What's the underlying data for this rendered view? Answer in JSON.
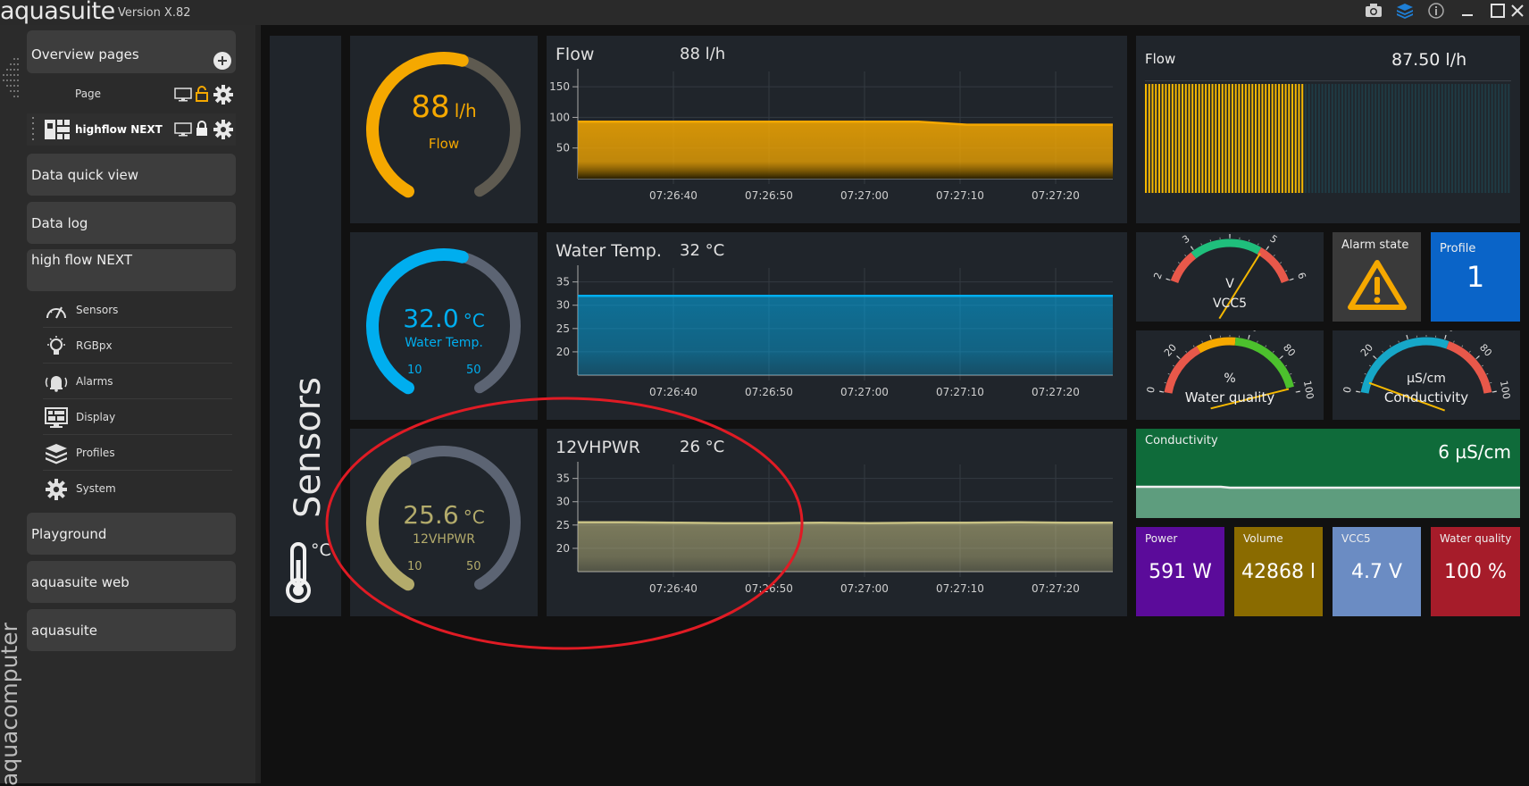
{
  "app": {
    "title": "aquasuite",
    "version": "Version X.82"
  },
  "titlebar_icons": [
    "camera-icon",
    "layers-icon",
    "info-icon",
    "minimize-icon",
    "maximize-icon",
    "close-icon"
  ],
  "sidebar": {
    "overview_label": "Overview pages",
    "pages": [
      {
        "label": "Page"
      },
      {
        "label": "highflow NEXT"
      }
    ],
    "sections": [
      {
        "label": "Data quick view"
      },
      {
        "label": "Data log"
      },
      {
        "label": "high flow NEXT"
      }
    ],
    "device_items": [
      {
        "label": "Sensors",
        "icon": "gauge-icon"
      },
      {
        "label": "RGBpx",
        "icon": "lightbulb-icon"
      },
      {
        "label": "Alarms",
        "icon": "alarm-bell-icon"
      },
      {
        "label": "Display",
        "icon": "display-icon"
      },
      {
        "label": "Profiles",
        "icon": "layers-icon"
      },
      {
        "label": "System",
        "icon": "gear-icon"
      }
    ],
    "bottom_sections": [
      {
        "label": "Playground"
      },
      {
        "label": "aquasuite web"
      },
      {
        "label": "aquasuite"
      }
    ],
    "brand_vertical": "aquacomputer"
  },
  "sensors_panel": {
    "title": "Sensors",
    "unit_icon": "°C"
  },
  "gauges": [
    {
      "value": "88",
      "unit": "l/h",
      "label": "Flow",
      "color": "#f5a800",
      "fraction": 0.55,
      "min": "",
      "max": ""
    },
    {
      "value": "32.0",
      "unit": "°C",
      "label": "Water Temp.",
      "color": "#00aeef",
      "fraction": 0.55,
      "min": "10",
      "max": "50"
    },
    {
      "value": "25.6",
      "unit": "°C",
      "label": "12VHPWR",
      "color": "#b3ab6b",
      "fraction": 0.39,
      "min": "10",
      "max": "50"
    }
  ],
  "chart_data": [
    {
      "type": "area",
      "title": "Flow",
      "value_text": "88 l/h",
      "x": [
        "07:26:40",
        "07:26:50",
        "07:27:00",
        "07:27:10",
        "07:27:20"
      ],
      "ylim": [
        0,
        175
      ],
      "yticks": [
        50,
        100,
        150
      ],
      "series": [
        {
          "values": [
            93,
            93,
            93,
            93,
            93,
            93,
            93,
            93,
            88,
            88,
            88,
            88
          ]
        }
      ],
      "color": "#f5a800"
    },
    {
      "type": "area",
      "title": "Water Temp.",
      "value_text": "32 °C",
      "x": [
        "07:26:40",
        "07:26:50",
        "07:27:00",
        "07:27:10",
        "07:27:20"
      ],
      "ylim": [
        15,
        38
      ],
      "yticks": [
        20,
        25,
        30,
        35
      ],
      "series": [
        {
          "values": [
            32,
            32,
            32,
            32,
            32,
            32,
            32,
            32,
            32,
            32,
            32,
            32
          ]
        }
      ],
      "color": "#00aeef"
    },
    {
      "type": "area",
      "title": "12VHPWR",
      "value_text": "26 °C",
      "x": [
        "07:26:40",
        "07:26:50",
        "07:27:00",
        "07:27:10",
        "07:27:20"
      ],
      "ylim": [
        15,
        38
      ],
      "yticks": [
        20,
        25,
        30,
        35
      ],
      "series": [
        {
          "values": [
            25.6,
            25.6,
            25.5,
            25.4,
            25.4,
            25.5,
            25.4,
            25.5,
            25.5,
            25.6,
            25.5,
            25.5
          ]
        }
      ],
      "color": "#c7c184"
    }
  ],
  "flow_bar": {
    "title": "Flow",
    "value_text": "87.50 l/h",
    "fraction": 0.44,
    "color": "#f5b800"
  },
  "mini_gauges": [
    {
      "unit": "V",
      "label": "VCC5",
      "ticks": [
        "2",
        "3",
        "4",
        "5",
        "6"
      ]
    },
    {
      "unit": "%",
      "label": "Water quality",
      "ticks": [
        "0",
        "20",
        "40",
        "60",
        "80",
        "100"
      ]
    },
    {
      "unit": "µS/cm",
      "label": "Conductivity",
      "ticks": [
        "0",
        "20",
        "40",
        "60",
        "80",
        "100"
      ]
    }
  ],
  "alarm_tile": {
    "title": "Alarm state"
  },
  "profile_tile": {
    "title": "Profile",
    "value": "1"
  },
  "conductivity_tile": {
    "title": "Conductivity",
    "value": "6 µS/cm"
  },
  "value_tiles": [
    {
      "title": "Power",
      "value": "591 W",
      "color": "#5b0b9a"
    },
    {
      "title": "Volume",
      "value": "42868 l",
      "color": "#8a6b00"
    },
    {
      "title": "VCC5",
      "value": "4.7 V",
      "color": "#6b8cc3"
    },
    {
      "title": "Water quality",
      "value": "100 %",
      "color": "#a61c2a"
    }
  ],
  "annotation": {
    "color": "#e01b24"
  }
}
